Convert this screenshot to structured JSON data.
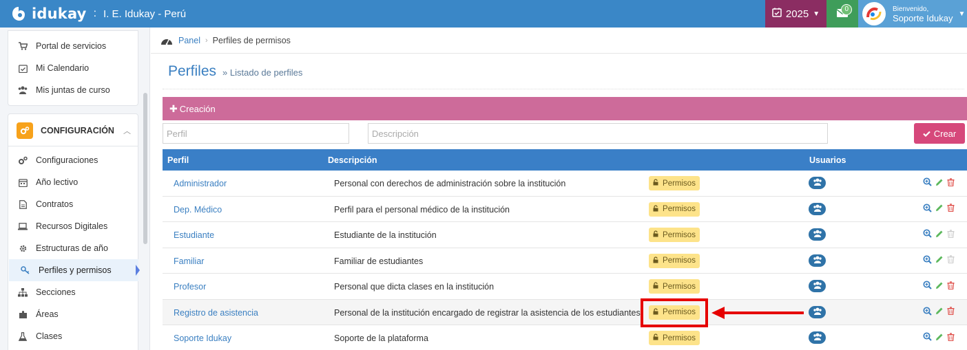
{
  "topbar": {
    "brand": "idukay",
    "separator": ":",
    "institution": "I. E. Idukay - Perú",
    "year": "2025",
    "mail_count": "0",
    "greeting": "Bienvenido,",
    "user_name": "Soporte Idukay"
  },
  "sidebar": {
    "top_items": [
      {
        "label": "Portal de servicios",
        "icon": "cart-icon"
      },
      {
        "label": "Mi Calendario",
        "icon": "calendar-check-icon"
      },
      {
        "label": "Mis juntas de curso",
        "icon": "users-icon"
      }
    ],
    "config_title": "CONFIGURACIÓN",
    "config_items": [
      {
        "label": "Configuraciones",
        "icon": "cogs-icon"
      },
      {
        "label": "Año lectivo",
        "icon": "calendar-icon"
      },
      {
        "label": "Contratos",
        "icon": "file-icon"
      },
      {
        "label": "Recursos Digitales",
        "icon": "laptop-icon"
      },
      {
        "label": "Estructuras de año",
        "icon": "gear-icon"
      },
      {
        "label": "Perfiles y permisos",
        "icon": "key-icon"
      },
      {
        "label": "Secciones",
        "icon": "sitemap-icon"
      },
      {
        "label": "Áreas",
        "icon": "puzzle-icon"
      },
      {
        "label": "Clases",
        "icon": "flask-icon"
      }
    ]
  },
  "breadcrumb": {
    "root": "Panel",
    "current": "Perfiles de permisos"
  },
  "page": {
    "title": "Perfiles",
    "subtitle": "» Listado de perfiles"
  },
  "creation": {
    "label": "Creación",
    "perfil_placeholder": "Perfil",
    "descripcion_placeholder": "Descripción",
    "crear_label": "Crear"
  },
  "table": {
    "headers": {
      "perfil": "Perfil",
      "descripcion": "Descripción",
      "usuarios": "Usuarios"
    },
    "permisos_label": "Permisos",
    "rows": [
      {
        "perfil": "Administrador",
        "descripcion": "Personal con derechos de administración sobre la institución",
        "delete_enabled": true
      },
      {
        "perfil": "Dep. Médico",
        "descripcion": "Perfil para el personal médico de la institución",
        "delete_enabled": true
      },
      {
        "perfil": "Estudiante",
        "descripcion": "Estudiante de la institución",
        "delete_enabled": false
      },
      {
        "perfil": "Familiar",
        "descripcion": "Familiar de estudiantes",
        "delete_enabled": false
      },
      {
        "perfil": "Profesor",
        "descripcion": "Personal que dicta clases en la institución",
        "delete_enabled": true
      },
      {
        "perfil": "Registro de asistencia",
        "descripcion": "Personal de la institución encargado de registrar la asistencia de los estudiantes",
        "delete_enabled": true
      },
      {
        "perfil": "Soporte Idukay",
        "descripcion": "Soporte de la plataforma",
        "delete_enabled": true
      }
    ]
  },
  "colors": {
    "topbar": "#3a87c7",
    "year": "#8b2d62",
    "mail": "#3f9d5a",
    "creation_bar": "#cd6b9a",
    "crear": "#d6487b",
    "table_header": "#3a7fc7",
    "permisos": "#fde38a",
    "annotation": "#e60000"
  }
}
